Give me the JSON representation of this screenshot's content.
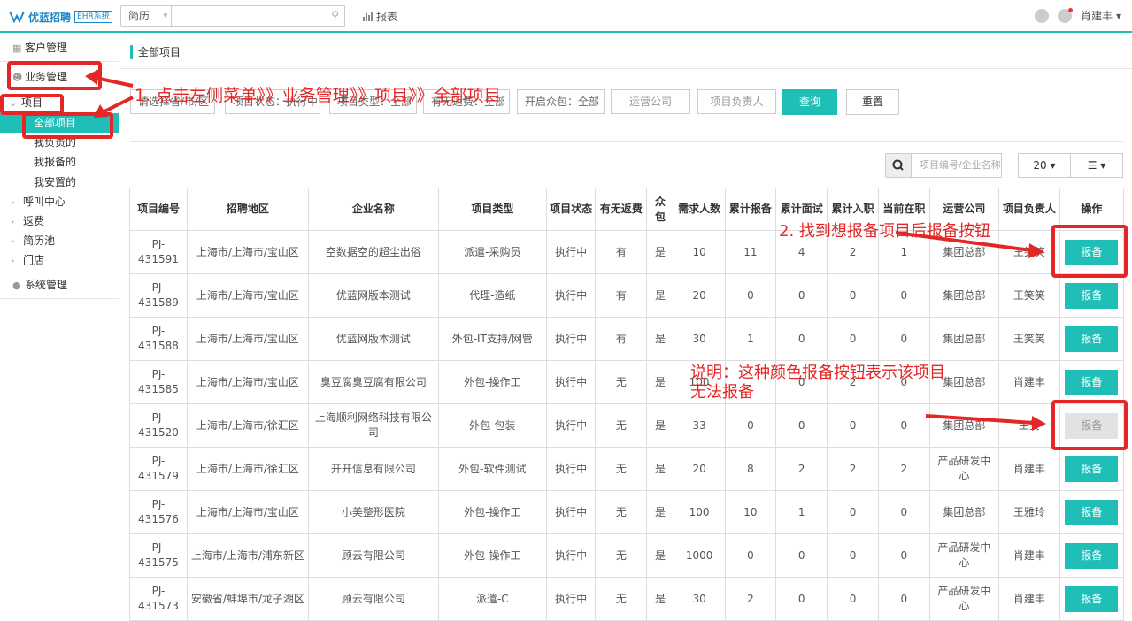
{
  "header": {
    "logo_text": "优蓝招聘",
    "logo_tag": "EHR系统",
    "search_type": "简历",
    "search_placeholder": "",
    "report_label": "报表",
    "user_name": "肖建丰"
  },
  "sidebar": {
    "items": [
      {
        "label": "客户管理"
      },
      {
        "label": "业务管理"
      },
      {
        "label": "项目"
      },
      {
        "label": "全部项目"
      },
      {
        "label": "我负责的"
      },
      {
        "label": "我报备的"
      },
      {
        "label": "我安置的"
      },
      {
        "label": "呼叫中心"
      },
      {
        "label": "返费"
      },
      {
        "label": "简历池"
      },
      {
        "label": "门店"
      },
      {
        "label": "系统管理"
      }
    ]
  },
  "breadcrumb": "全部项目",
  "filters": {
    "region": "请选择省/市/区",
    "status": "项目状态：执行中",
    "type": "项目类型：全部",
    "refund": "有无返费：全部",
    "crowd": "开启众包：全部",
    "ops_company_placeholder": "运营公司",
    "owner_placeholder": "项目负责人",
    "query_label": "查询",
    "reset_label": "重置"
  },
  "table_tools": {
    "search_placeholder": "项目编号/企业名称",
    "page_size": "20",
    "caret": "▾"
  },
  "table": {
    "columns": [
      "项目编号",
      "招聘地区",
      "企业名称",
      "项目类型",
      "项目状态",
      "有无返费",
      "众包",
      "需求人数",
      "累计报备",
      "累计面试",
      "累计入职",
      "当前在职",
      "运营公司",
      "项目负责人",
      "操作"
    ],
    "rows": [
      {
        "id": "PJ-431591",
        "region": "上海市/上海市/宝山区",
        "company": "空数据空的超尘出俗",
        "type": "派遣-采购员",
        "status": "执行中",
        "refund": "有",
        "crowd": "是",
        "demand": "10",
        "reported": "11",
        "interviewed": "4",
        "hired": "2",
        "employed": "1",
        "ops": "集团总部",
        "owner": "王笑笑",
        "action": "报备",
        "enabled": true
      },
      {
        "id": "PJ-431589",
        "region": "上海市/上海市/宝山区",
        "company": "优蓝网版本测试",
        "type": "代理-造纸",
        "status": "执行中",
        "refund": "有",
        "crowd": "是",
        "demand": "20",
        "reported": "0",
        "interviewed": "0",
        "hired": "0",
        "employed": "0",
        "ops": "集团总部",
        "owner": "王笑笑",
        "action": "报备",
        "enabled": true
      },
      {
        "id": "PJ-431588",
        "region": "上海市/上海市/宝山区",
        "company": "优蓝网版本测试",
        "type": "外包-IT支持/网管",
        "status": "执行中",
        "refund": "有",
        "crowd": "是",
        "demand": "30",
        "reported": "1",
        "interviewed": "0",
        "hired": "0",
        "employed": "0",
        "ops": "集团总部",
        "owner": "王笑笑",
        "action": "报备",
        "enabled": true
      },
      {
        "id": "PJ-431585",
        "region": "上海市/上海市/宝山区",
        "company": "臭豆腐臭豆腐有限公司",
        "type": "外包-操作工",
        "status": "执行中",
        "refund": "无",
        "crowd": "是",
        "demand": "100",
        "reported": "",
        "interviewed": "0",
        "hired": "2",
        "employed": "0",
        "ops": "集团总部",
        "owner": "肖建丰",
        "action": "报备",
        "enabled": true
      },
      {
        "id": "PJ-431520",
        "region": "上海市/上海市/徐汇区",
        "company": "上海顺利网络科技有限公司",
        "type": "外包-包装",
        "status": "执行中",
        "refund": "无",
        "crowd": "是",
        "demand": "33",
        "reported": "0",
        "interviewed": "0",
        "hired": "0",
        "employed": "0",
        "ops": "集团总部",
        "owner": "王笑",
        "action": "报备",
        "enabled": false
      },
      {
        "id": "PJ-431579",
        "region": "上海市/上海市/徐汇区",
        "company": "开开信息有限公司",
        "type": "外包-软件测试",
        "status": "执行中",
        "refund": "无",
        "crowd": "是",
        "demand": "20",
        "reported": "8",
        "interviewed": "2",
        "hired": "2",
        "employed": "2",
        "ops": "产品研发中心",
        "owner": "肖建丰",
        "action": "报备",
        "enabled": true
      },
      {
        "id": "PJ-431576",
        "region": "上海市/上海市/宝山区",
        "company": "小美整形医院",
        "type": "外包-操作工",
        "status": "执行中",
        "refund": "无",
        "crowd": "是",
        "demand": "100",
        "reported": "10",
        "interviewed": "1",
        "hired": "0",
        "employed": "0",
        "ops": "集团总部",
        "owner": "王雅玲",
        "action": "报备",
        "enabled": true
      },
      {
        "id": "PJ-431575",
        "region": "上海市/上海市/浦东新区",
        "company": "顾云有限公司",
        "type": "外包-操作工",
        "status": "执行中",
        "refund": "无",
        "crowd": "是",
        "demand": "1000",
        "reported": "0",
        "interviewed": "0",
        "hired": "0",
        "employed": "0",
        "ops": "产品研发中心",
        "owner": "肖建丰",
        "action": "报备",
        "enabled": true
      },
      {
        "id": "PJ-431573",
        "region": "安徽省/蚌埠市/龙子湖区",
        "company": "顾云有限公司",
        "type": "派遣-C",
        "status": "执行中",
        "refund": "无",
        "crowd": "是",
        "demand": "30",
        "reported": "2",
        "interviewed": "0",
        "hired": "0",
        "employed": "0",
        "ops": "产品研发中心",
        "owner": "肖建丰",
        "action": "报备",
        "enabled": true
      }
    ]
  },
  "annotations": {
    "step1": "1. 点击左侧菜单》》业务管理》》项目》》全部项目",
    "step2": "2. 找到想报备项目后报备按钮",
    "note_line1": "说明：这种颜色报备按钮表示该项目",
    "note_line2": "无法报备",
    "color": "#e52626"
  },
  "colors": {
    "accent": "#1fbfb8",
    "link": "#1fb5b0",
    "disabled": "#e2e2e2"
  }
}
